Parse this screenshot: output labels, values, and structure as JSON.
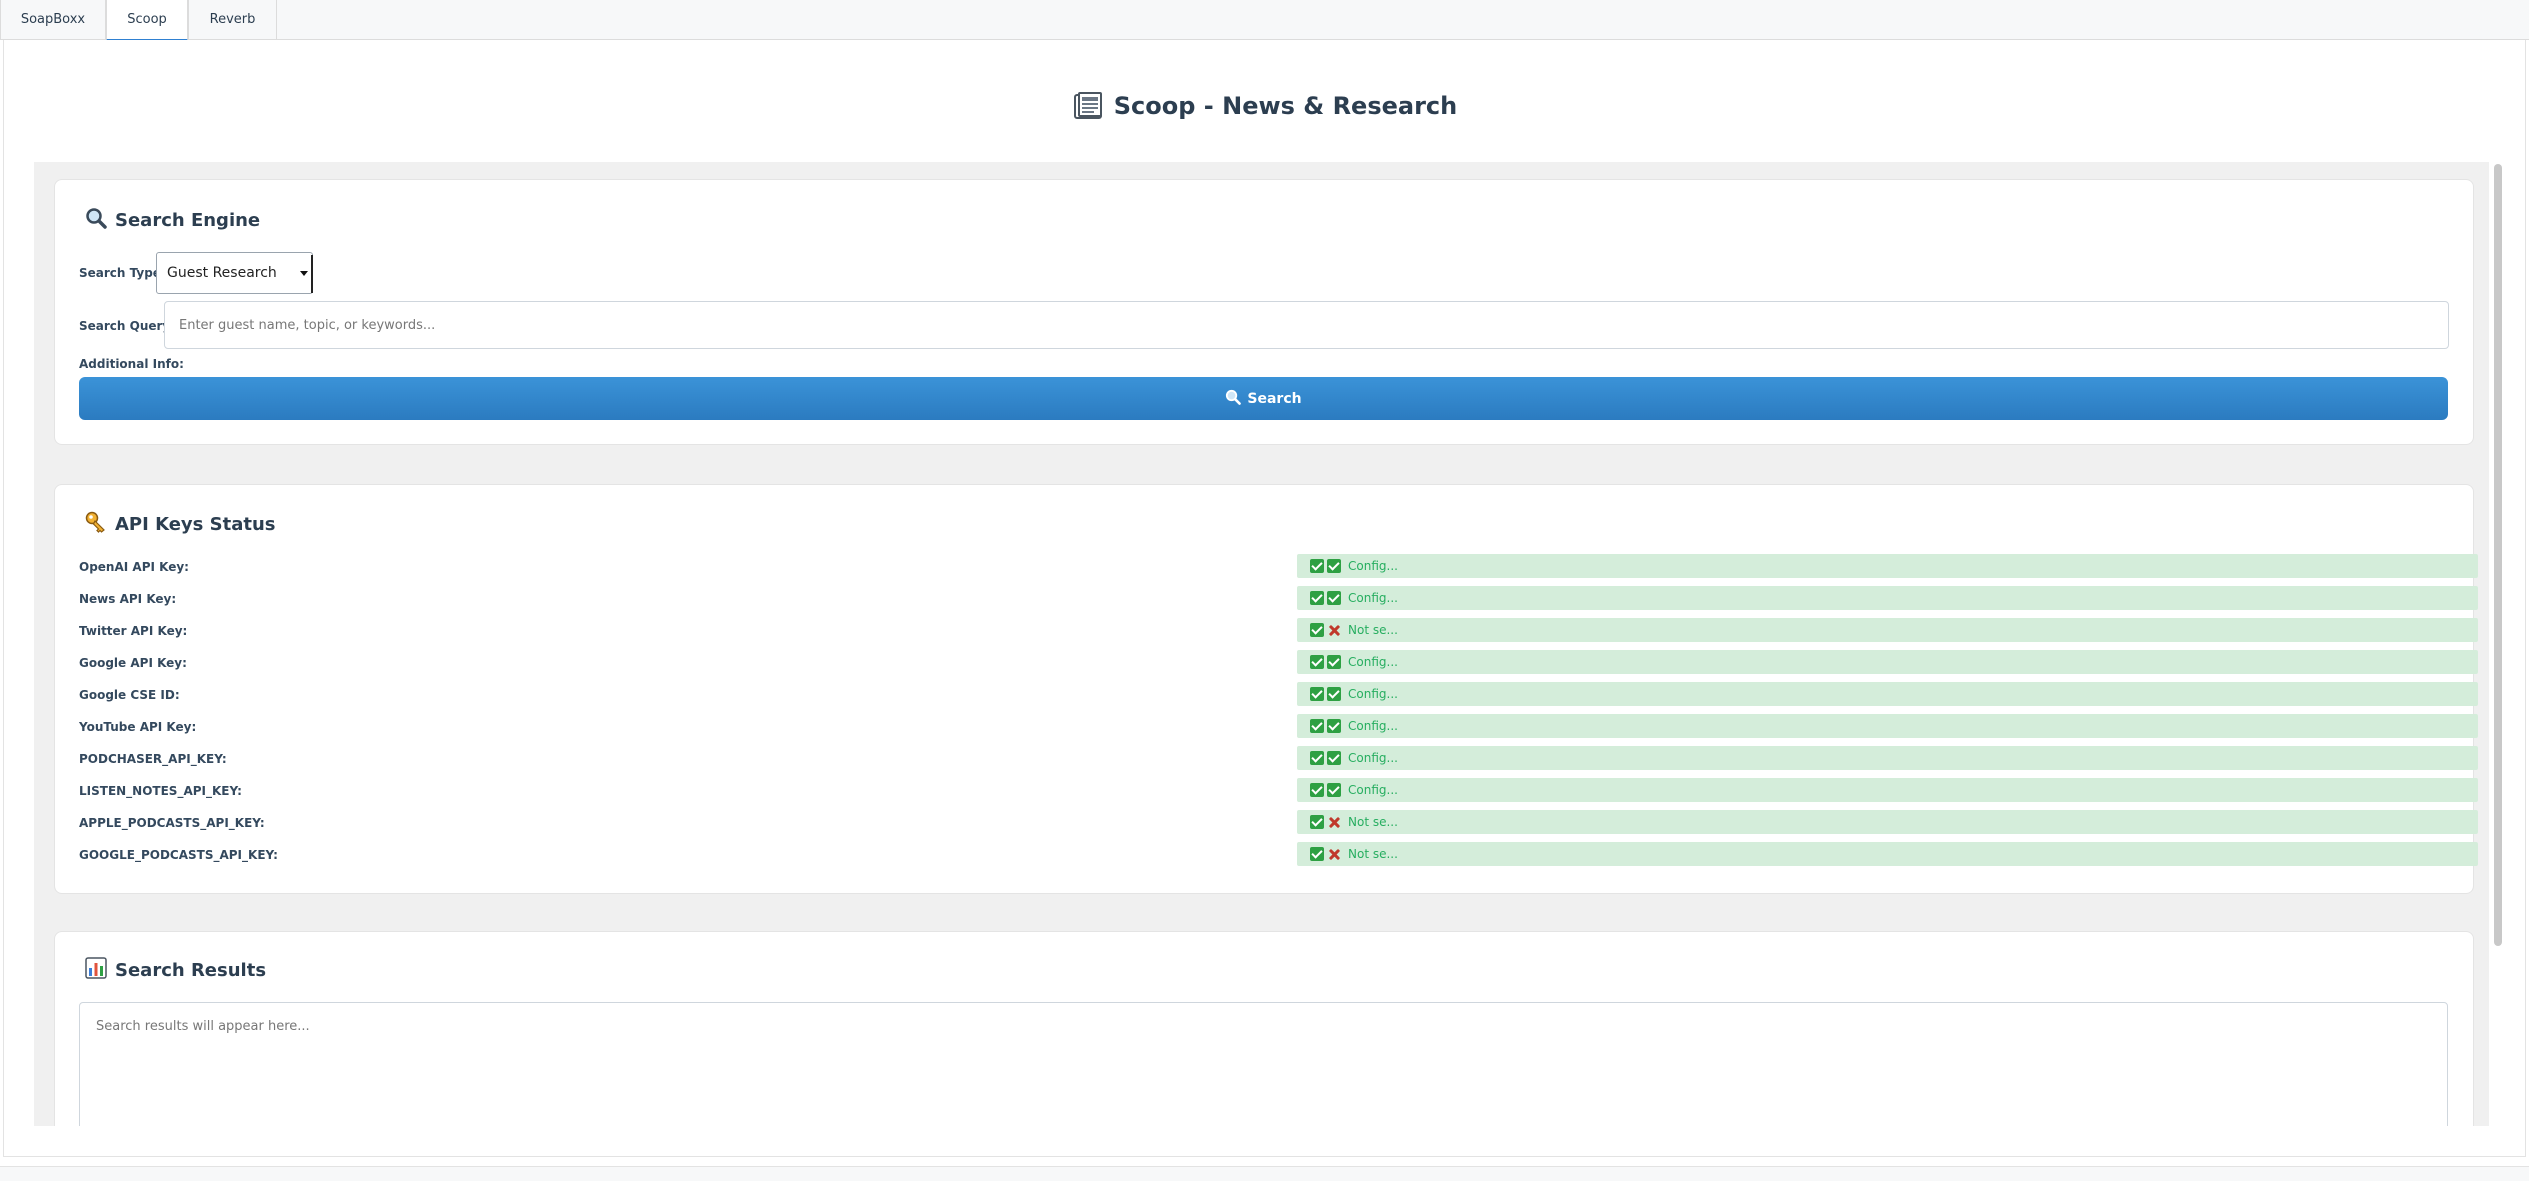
{
  "tabs": [
    {
      "label": "SoapBoxx"
    },
    {
      "label": "Scoop"
    },
    {
      "label": "Reverb"
    }
  ],
  "page_title": "Scoop - News & Research",
  "search_engine": {
    "heading": "Search Engine",
    "search_type_label": "Search Type:",
    "search_type_value": "Guest Research",
    "search_query_label": "Search Query:",
    "search_query_placeholder": "Enter guest name, topic, or keywords...",
    "additional_info_label": "Additional Info:",
    "search_button_label": "Search"
  },
  "api_keys": {
    "heading": "API Keys Status",
    "rows": [
      {
        "label": "OpenAI API Key:",
        "status": "ok",
        "text": "Config..."
      },
      {
        "label": "News API Key:",
        "status": "ok",
        "text": "Config..."
      },
      {
        "label": "Twitter API Key:",
        "status": "missing",
        "text": "Not se..."
      },
      {
        "label": "Google API Key:",
        "status": "ok",
        "text": "Config..."
      },
      {
        "label": "Google CSE ID:",
        "status": "ok",
        "text": "Config..."
      },
      {
        "label": "YouTube API Key:",
        "status": "ok",
        "text": "Config..."
      },
      {
        "label": "PODCHASER_API_KEY:",
        "status": "ok",
        "text": "Config..."
      },
      {
        "label": "LISTEN_NOTES_API_KEY:",
        "status": "ok",
        "text": "Config..."
      },
      {
        "label": "APPLE_PODCASTS_API_KEY:",
        "status": "missing",
        "text": "Not se..."
      },
      {
        "label": "GOOGLE_PODCASTS_API_KEY:",
        "status": "missing",
        "text": "Not se..."
      }
    ]
  },
  "search_results": {
    "heading": "Search Results",
    "placeholder": "Search results will appear here..."
  },
  "colors": {
    "accent": "#2f80d1",
    "ok_bg": "#d4edda",
    "ok_text": "#27ae60",
    "missing_icon": "#c0392b"
  },
  "icons": {
    "title": "newspaper-icon",
    "search_engine": "magnifier-icon",
    "api_keys": "key-icon",
    "results": "bar-chart-icon"
  }
}
